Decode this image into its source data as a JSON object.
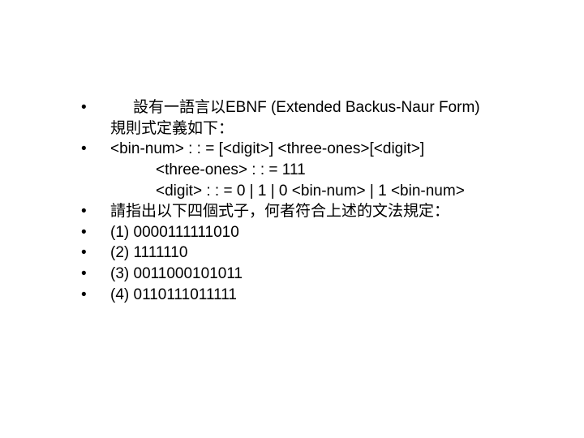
{
  "items": [
    {
      "line1": "設有一語言以EBNF (Extended Backus-Naur Form)",
      "line2": "規則式定義如下："
    },
    {
      "grammar1": "<bin-num> : : = [<digit>] <three-ones>[<digit>]",
      "grammar2": "<three-ones> : : = 111",
      "grammar3": "<digit> : : = 0 | 1 | 0 <bin-num> | 1 <bin-num>"
    },
    {
      "text": "請指出以下四個式子，何者符合上述的文法規定："
    },
    {
      "text": "(1)  0000111111010"
    },
    {
      "text": "(2)  1111110"
    },
    {
      "text": "(3)  0011000101011"
    },
    {
      "text": "(4)  0110111011111"
    }
  ]
}
